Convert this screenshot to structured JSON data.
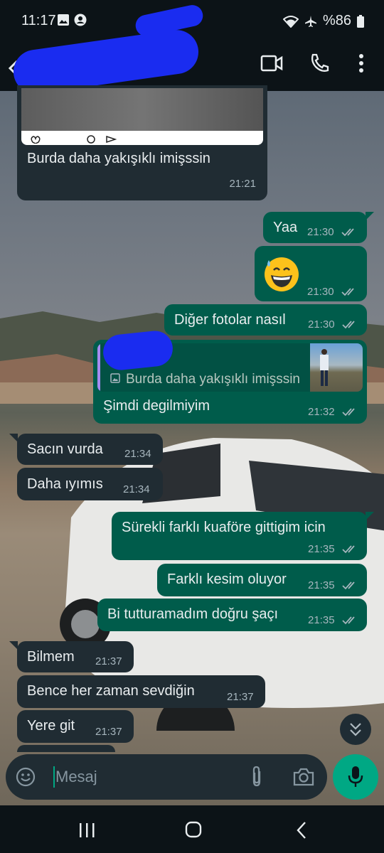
{
  "status_bar": {
    "time": "11:17",
    "battery": "%86"
  },
  "header": {
    "icons": [
      "back-arrow-icon",
      "video-call-icon",
      "voice-call-icon",
      "more-options-icon"
    ]
  },
  "messages": [
    {
      "direction": "in",
      "text": "Burda daha yakışıklı imişssin",
      "time": "21:21"
    },
    {
      "direction": "out",
      "text": "Yaa",
      "time": "21:30"
    },
    {
      "direction": "out",
      "emoji": "😅",
      "time": "21:30"
    },
    {
      "direction": "out",
      "text": "Diğer fotolar nasıl",
      "time": "21:30"
    },
    {
      "direction": "out",
      "quote": "Burda daha yakışıklı imişssin",
      "text": "Şimdi degilmiyim",
      "time": "21:32"
    },
    {
      "direction": "in",
      "text": "Sacın vurda",
      "time": "21:34"
    },
    {
      "direction": "in",
      "text": "Daha ıyımıs",
      "time": "21:34"
    },
    {
      "direction": "out",
      "text": "Sürekli farklı kuaföre gittigim icin",
      "time": "21:35"
    },
    {
      "direction": "out",
      "text": "Farklı kesim oluyor",
      "time": "21:35"
    },
    {
      "direction": "out",
      "text": "Bi tutturamadım doğru şaçı",
      "time": "21:35"
    },
    {
      "direction": "in",
      "text": "Bilmem",
      "time": "21:37"
    },
    {
      "direction": "in",
      "text": "Bence her zaman sevdiğin",
      "time": "21:37"
    },
    {
      "direction": "in",
      "text": "Yere git",
      "time": "21:37"
    }
  ],
  "input": {
    "placeholder": "Mesaj"
  },
  "colors": {
    "outgoing_bubble": "#005c4b",
    "incoming_bubble": "#202c33",
    "accent": "#00a884",
    "header": "#0c1317",
    "redaction": "#1a2cf0"
  }
}
